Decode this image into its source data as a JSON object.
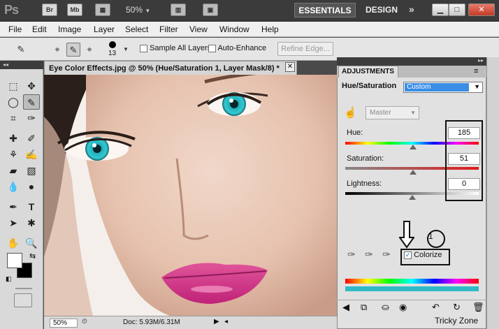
{
  "app": {
    "logo": "Ps",
    "btn_br": "Br",
    "btn_mb": "Mb",
    "zoom": "50%",
    "dropdown_glyph": "▼",
    "win_min": "▁",
    "win_max": "□",
    "win_close": "✕"
  },
  "workspace": {
    "essentials": "ESSENTIALS",
    "design": "DESIGN",
    "more": "»"
  },
  "menu": [
    "File",
    "Edit",
    "Image",
    "Layer",
    "Select",
    "Filter",
    "View",
    "Window",
    "Help"
  ],
  "options": {
    "brush_size": "13",
    "sample_all_layers": "Sample All Layers",
    "auto_enhance": "Auto-Enhance",
    "refine_edge": "Refine Edge..."
  },
  "document": {
    "tab_title": "Eye Color Effects.jpg @ 50% (Hue/Saturation 1, Layer Mask/8) *",
    "close": "✕"
  },
  "status": {
    "zoom": "50%",
    "doc_size": "Doc: 5.93M/6.31M"
  },
  "adjustments": {
    "tab": "ADJUSTMENTS",
    "title": "Hue/Saturation",
    "preset": "Custom",
    "channel": "Master",
    "hue_label": "Hue:",
    "hue_value": "185",
    "hue_pos": 0.51,
    "sat_label": "Saturation:",
    "sat_value": "51",
    "sat_pos": 0.51,
    "light_label": "Lightness:",
    "light_value": "0",
    "light_pos": 0.5,
    "colorize_label": "Colorize",
    "colorize_checked": true,
    "callout_number": "1"
  },
  "watermark": "Tricky Zone"
}
